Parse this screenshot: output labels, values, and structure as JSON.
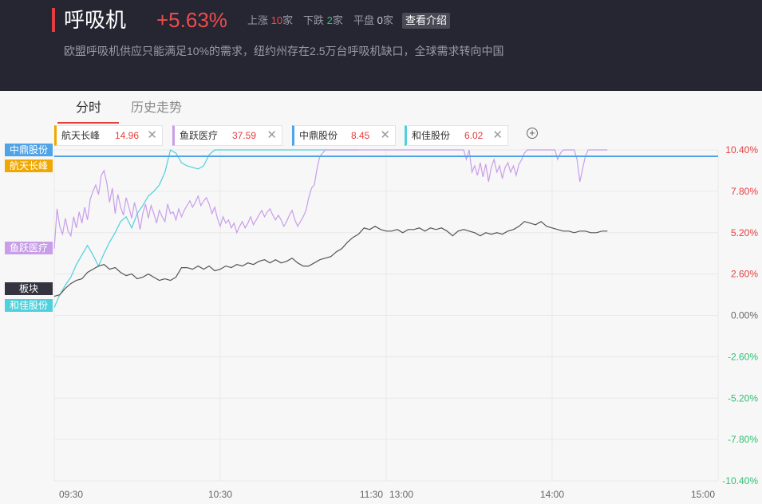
{
  "header": {
    "title": "呼吸机",
    "change": "+5.63%",
    "up_label": "上涨",
    "up_count": "10",
    "down_label": "下跌",
    "down_count": "2",
    "flat_label": "平盘",
    "flat_count": "0",
    "unit": "家",
    "intro_button": "查看介绍",
    "description": "欧盟呼吸机供应只能满足10%的需求，纽约州存在2.5万台呼吸机缺口，全球需求转向中国"
  },
  "tabs": [
    {
      "label": "分时",
      "active": true
    },
    {
      "label": "历史走势",
      "active": false
    }
  ],
  "add_icon": "plus-circle-icon",
  "close_icon": "close-icon",
  "chips": [
    {
      "name": "航天长峰",
      "price": "14.96",
      "color": "#f0a800"
    },
    {
      "name": "鱼跃医疗",
      "price": "37.59",
      "color": "#c89ee8"
    },
    {
      "name": "中鼎股份",
      "price": "8.45",
      "color": "#4fa3e6"
    },
    {
      "name": "和佳股份",
      "price": "6.02",
      "color": "#4fd0dc"
    }
  ],
  "chart_data": {
    "type": "line",
    "x_ticks": [
      "09:30",
      "10:30",
      "11:30",
      "13:00",
      "14:00",
      "15:00"
    ],
    "y_ticks": [
      "10.40%",
      "7.80%",
      "5.20%",
      "2.60%",
      "0.00%",
      "-2.60%",
      "-5.20%",
      "-7.80%",
      "-10.40%"
    ],
    "ylim": [
      -10.4,
      10.4
    ],
    "x_range": [
      0,
      240
    ],
    "colors": {
      "up": "#e53e3e",
      "down": "#2fbf71",
      "zero": "#666666"
    },
    "series": [
      {
        "name": "中鼎股份",
        "color": "#4fa3e6",
        "label_bg": "#4fa3e6",
        "last": 10.0,
        "points": [
          [
            0,
            10.0
          ],
          [
            240,
            10.0
          ]
        ]
      },
      {
        "name": "航天长峰",
        "color": "#f0a800",
        "label_bg": "#f0a800",
        "last": 9.2,
        "points": [
          [
            0,
            9.2
          ]
        ]
      },
      {
        "name": "鱼跃医疗",
        "color": "#c89ee8",
        "label_bg": "#c89ee8",
        "last": 4.0,
        "points": [
          [
            0,
            4.2
          ],
          [
            1,
            6.7
          ],
          [
            2,
            5.6
          ],
          [
            3,
            5.1
          ],
          [
            4,
            6.1
          ],
          [
            5,
            5.3
          ],
          [
            6,
            5.0
          ],
          [
            7,
            6.2
          ],
          [
            8,
            5.5
          ],
          [
            9,
            6.5
          ],
          [
            10,
            5.8
          ],
          [
            11,
            6.8
          ],
          [
            12,
            6.0
          ],
          [
            13,
            7.3
          ],
          [
            14,
            7.8
          ],
          [
            15,
            8.2
          ],
          [
            16,
            7.6
          ],
          [
            17,
            8.8
          ],
          [
            18,
            9.1
          ],
          [
            19,
            8.3
          ],
          [
            20,
            7.1
          ],
          [
            21,
            8.0
          ],
          [
            22,
            6.4
          ],
          [
            23,
            7.6
          ],
          [
            24,
            6.8
          ],
          [
            25,
            6.3
          ],
          [
            26,
            7.4
          ],
          [
            27,
            6.8
          ],
          [
            28,
            6.1
          ],
          [
            29,
            7.1
          ],
          [
            30,
            6.4
          ],
          [
            31,
            5.4
          ],
          [
            32,
            6.4
          ],
          [
            33,
            7.0
          ],
          [
            34,
            6.1
          ],
          [
            35,
            6.9
          ],
          [
            36,
            6.4
          ],
          [
            37,
            5.8
          ],
          [
            38,
            6.6
          ],
          [
            39,
            6.2
          ],
          [
            40,
            5.9
          ],
          [
            41,
            7.0
          ],
          [
            42,
            6.4
          ],
          [
            43,
            6.5
          ],
          [
            44,
            6.0
          ],
          [
            45,
            6.7
          ],
          [
            46,
            6.2
          ],
          [
            47,
            6.6
          ],
          [
            48,
            6.9
          ],
          [
            49,
            7.2
          ],
          [
            50,
            6.8
          ],
          [
            51,
            7.1
          ],
          [
            52,
            7.5
          ],
          [
            53,
            6.9
          ],
          [
            54,
            7.2
          ],
          [
            55,
            7.4
          ],
          [
            56,
            7.0
          ],
          [
            57,
            6.4
          ],
          [
            58,
            6.8
          ],
          [
            59,
            6.1
          ],
          [
            60,
            5.6
          ],
          [
            61,
            6.2
          ],
          [
            62,
            5.8
          ],
          [
            63,
            6.0
          ],
          [
            64,
            5.5
          ],
          [
            65,
            5.8
          ],
          [
            66,
            5.2
          ],
          [
            67,
            5.6
          ],
          [
            68,
            5.9
          ],
          [
            69,
            5.5
          ],
          [
            70,
            5.8
          ],
          [
            71,
            6.2
          ],
          [
            72,
            5.7
          ],
          [
            73,
            6.0
          ],
          [
            74,
            6.3
          ],
          [
            75,
            6.6
          ],
          [
            76,
            6.2
          ],
          [
            77,
            6.5
          ],
          [
            78,
            6.7
          ],
          [
            79,
            6.3
          ],
          [
            80,
            6.0
          ],
          [
            81,
            6.3
          ],
          [
            82,
            6.0
          ],
          [
            83,
            5.6
          ],
          [
            84,
            5.9
          ],
          [
            85,
            6.3
          ],
          [
            86,
            6.6
          ],
          [
            87,
            6.0
          ],
          [
            88,
            5.6
          ],
          [
            89,
            5.9
          ],
          [
            90,
            6.2
          ],
          [
            91,
            6.6
          ],
          [
            92,
            7.4
          ],
          [
            93,
            8.0
          ],
          [
            94,
            8.2
          ],
          [
            95,
            9.2
          ],
          [
            96,
            10.0
          ],
          [
            97,
            10.2
          ],
          [
            98,
            10.4
          ],
          [
            120,
            10.4
          ],
          [
            148,
            10.4
          ],
          [
            149,
            9.8
          ],
          [
            150,
            10.4
          ],
          [
            151,
            9.0
          ],
          [
            152,
            9.4
          ],
          [
            153,
            8.8
          ],
          [
            154,
            9.6
          ],
          [
            155,
            8.7
          ],
          [
            156,
            9.5
          ],
          [
            157,
            8.4
          ],
          [
            158,
            9.3
          ],
          [
            159,
            9.8
          ],
          [
            160,
            9.0
          ],
          [
            161,
            9.4
          ],
          [
            162,
            8.6
          ],
          [
            163,
            9.3
          ],
          [
            164,
            9.6
          ],
          [
            165,
            9.0
          ],
          [
            166,
            9.4
          ],
          [
            167,
            8.8
          ],
          [
            168,
            9.5
          ],
          [
            169,
            9.8
          ],
          [
            170,
            10.2
          ],
          [
            171,
            10.4
          ],
          [
            181,
            10.4
          ],
          [
            182,
            9.8
          ],
          [
            183,
            10.2
          ],
          [
            184,
            10.4
          ],
          [
            188,
            10.4
          ],
          [
            189,
            9.8
          ],
          [
            190,
            8.4
          ],
          [
            191,
            9.2
          ],
          [
            192,
            10.0
          ],
          [
            193,
            10.4
          ],
          [
            200,
            10.4
          ]
        ]
      },
      {
        "name": "板块",
        "color": "#555555",
        "label_bg": "#33343f",
        "last": 1.2,
        "points": [
          [
            0,
            1.2
          ],
          [
            2,
            1.3
          ],
          [
            4,
            1.7
          ],
          [
            6,
            2.0
          ],
          [
            8,
            2.2
          ],
          [
            10,
            2.3
          ],
          [
            12,
            2.7
          ],
          [
            14,
            2.9
          ],
          [
            16,
            3.1
          ],
          [
            18,
            3.2
          ],
          [
            20,
            2.9
          ],
          [
            22,
            3.0
          ],
          [
            24,
            2.7
          ],
          [
            26,
            2.5
          ],
          [
            28,
            2.6
          ],
          [
            30,
            2.3
          ],
          [
            32,
            2.4
          ],
          [
            34,
            2.6
          ],
          [
            36,
            2.4
          ],
          [
            38,
            2.2
          ],
          [
            40,
            2.3
          ],
          [
            42,
            2.2
          ],
          [
            44,
            2.4
          ],
          [
            46,
            3.0
          ],
          [
            48,
            3.0
          ],
          [
            50,
            2.9
          ],
          [
            52,
            3.1
          ],
          [
            54,
            2.9
          ],
          [
            56,
            3.1
          ],
          [
            58,
            2.8
          ],
          [
            60,
            2.9
          ],
          [
            62,
            3.1
          ],
          [
            64,
            3.0
          ],
          [
            66,
            3.2
          ],
          [
            68,
            3.1
          ],
          [
            70,
            3.3
          ],
          [
            72,
            3.2
          ],
          [
            74,
            3.4
          ],
          [
            76,
            3.5
          ],
          [
            78,
            3.3
          ],
          [
            80,
            3.5
          ],
          [
            82,
            3.3
          ],
          [
            84,
            3.4
          ],
          [
            86,
            3.6
          ],
          [
            88,
            3.3
          ],
          [
            90,
            3.1
          ],
          [
            92,
            3.1
          ],
          [
            94,
            3.3
          ],
          [
            96,
            3.5
          ],
          [
            98,
            3.6
          ],
          [
            100,
            3.7
          ],
          [
            102,
            4.0
          ],
          [
            104,
            4.2
          ],
          [
            106,
            4.6
          ],
          [
            108,
            4.9
          ],
          [
            110,
            5.1
          ],
          [
            112,
            5.5
          ],
          [
            114,
            5.4
          ],
          [
            116,
            5.6
          ],
          [
            118,
            5.4
          ],
          [
            120,
            5.3
          ],
          [
            122,
            5.3
          ],
          [
            124,
            5.4
          ],
          [
            126,
            5.2
          ],
          [
            128,
            5.4
          ],
          [
            130,
            5.4
          ],
          [
            132,
            5.5
          ],
          [
            134,
            5.3
          ],
          [
            136,
            5.5
          ],
          [
            138,
            5.4
          ],
          [
            140,
            5.5
          ],
          [
            142,
            5.3
          ],
          [
            144,
            5.0
          ],
          [
            146,
            5.3
          ],
          [
            148,
            5.4
          ],
          [
            150,
            5.3
          ],
          [
            152,
            5.2
          ],
          [
            154,
            5.0
          ],
          [
            156,
            5.2
          ],
          [
            158,
            5.1
          ],
          [
            160,
            5.2
          ],
          [
            162,
            5.1
          ],
          [
            164,
            5.3
          ],
          [
            166,
            5.4
          ],
          [
            168,
            5.6
          ],
          [
            170,
            5.9
          ],
          [
            172,
            5.8
          ],
          [
            174,
            5.7
          ],
          [
            176,
            5.9
          ],
          [
            178,
            5.6
          ],
          [
            180,
            5.5
          ],
          [
            182,
            5.4
          ],
          [
            184,
            5.3
          ],
          [
            186,
            5.3
          ],
          [
            188,
            5.2
          ],
          [
            190,
            5.3
          ],
          [
            192,
            5.3
          ],
          [
            194,
            5.2
          ],
          [
            196,
            5.2
          ],
          [
            198,
            5.3
          ],
          [
            200,
            5.3
          ]
        ]
      },
      {
        "name": "和佳股份",
        "color": "#4fd0dc",
        "label_bg": "#4fd0dc",
        "last": 0.4,
        "points": [
          [
            0,
            0.5
          ],
          [
            2,
            1.3
          ],
          [
            4,
            1.9
          ],
          [
            6,
            2.4
          ],
          [
            8,
            3.2
          ],
          [
            10,
            3.8
          ],
          [
            12,
            4.4
          ],
          [
            14,
            3.8
          ],
          [
            16,
            3.1
          ],
          [
            18,
            3.9
          ],
          [
            20,
            4.6
          ],
          [
            22,
            5.2
          ],
          [
            24,
            5.9
          ],
          [
            26,
            6.2
          ],
          [
            28,
            5.5
          ],
          [
            30,
            6.4
          ],
          [
            32,
            6.9
          ],
          [
            34,
            7.5
          ],
          [
            36,
            7.8
          ],
          [
            38,
            8.2
          ],
          [
            40,
            9.0
          ],
          [
            42,
            10.4
          ],
          [
            44,
            10.2
          ],
          [
            46,
            9.6
          ],
          [
            48,
            9.4
          ],
          [
            50,
            9.3
          ],
          [
            52,
            9.2
          ],
          [
            54,
            9.4
          ],
          [
            56,
            10.1
          ],
          [
            58,
            10.4
          ],
          [
            60,
            10.4
          ],
          [
            110,
            10.4
          ]
        ]
      }
    ]
  }
}
